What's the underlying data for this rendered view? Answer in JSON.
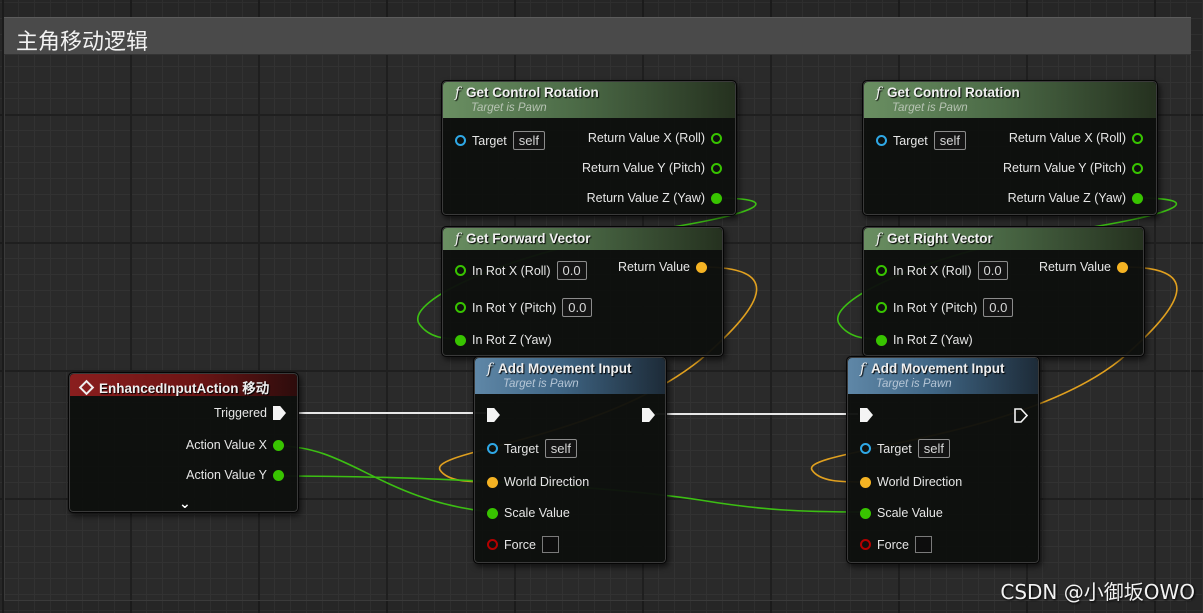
{
  "comment": {
    "title": "主角移动逻辑"
  },
  "nodes": {
    "get_control_rotation_1": {
      "title": "Get Control Rotation",
      "subtitle": "Target is Pawn",
      "target_label": "Target",
      "target_value": "self",
      "out_roll": "Return Value X (Roll)",
      "out_pitch": "Return Value Y (Pitch)",
      "out_yaw": "Return Value Z (Yaw)"
    },
    "get_control_rotation_2": {
      "title": "Get Control Rotation",
      "subtitle": "Target is Pawn",
      "target_label": "Target",
      "target_value": "self",
      "out_roll": "Return Value X (Roll)",
      "out_pitch": "Return Value Y (Pitch)",
      "out_yaw": "Return Value Z (Yaw)"
    },
    "get_forward_vector": {
      "title": "Get Forward Vector",
      "in_roll": "In Rot X (Roll)",
      "in_roll_value": "0.0",
      "in_pitch": "In Rot Y (Pitch)",
      "in_pitch_value": "0.0",
      "in_yaw": "In Rot Z (Yaw)",
      "return_value": "Return Value"
    },
    "get_right_vector": {
      "title": "Get Right Vector",
      "in_roll": "In Rot X (Roll)",
      "in_roll_value": "0.0",
      "in_pitch": "In Rot Y (Pitch)",
      "in_pitch_value": "0.0",
      "in_yaw": "In Rot Z (Yaw)",
      "return_value": "Return Value"
    },
    "enhanced_input_action": {
      "title": "EnhancedInputAction 移动",
      "triggered": "Triggered",
      "action_x": "Action Value X",
      "action_y": "Action Value Y",
      "expand": "⌄"
    },
    "add_movement_input_1": {
      "title": "Add Movement Input",
      "subtitle": "Target is Pawn",
      "target_label": "Target",
      "target_value": "self",
      "world_direction": "World Direction",
      "scale_value": "Scale Value",
      "force": "Force"
    },
    "add_movement_input_2": {
      "title": "Add Movement Input",
      "subtitle": "Target is Pawn",
      "target_label": "Target",
      "target_value": "self",
      "world_direction": "World Direction",
      "scale_value": "Scale Value",
      "force": "Force"
    }
  },
  "icons": {
    "function": "f",
    "event": "diamond-event-icon"
  },
  "colors": {
    "exec_wire": "#f4f4f4",
    "float_wire": "#38c400",
    "vector_wire": "#f5b323",
    "object_pin": "#2fa8e6",
    "bool_pin": "#b40000"
  },
  "watermark": "CSDN @小御坂OWO"
}
